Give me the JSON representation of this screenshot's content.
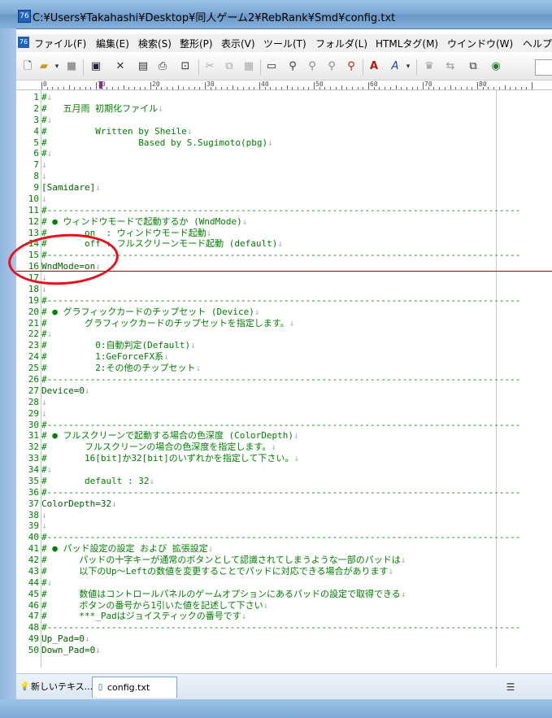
{
  "window": {
    "title": "C:¥Users¥Takahashi¥Desktop¥同人ゲーム2¥RebRank¥Smd¥config.txt",
    "app_icon_text": "76"
  },
  "menu": {
    "icon_text": "76",
    "items": [
      {
        "label": "ファイル(F)"
      },
      {
        "label": "編集(E)"
      },
      {
        "label": "検索(S)"
      },
      {
        "label": "整形(P)"
      },
      {
        "label": "表示(V)"
      },
      {
        "label": "ツール(T)"
      },
      {
        "label": "フォルダ(L)"
      },
      {
        "label": "HTMLタグ(M)"
      },
      {
        "label": "ウインドウ(W)"
      },
      {
        "label": "ヘルプ"
      }
    ]
  },
  "toolbar": {
    "icons": [
      "new-icon",
      "open-icon",
      "dropdown-icon",
      "save-gray-icon",
      "save-icon",
      "close-x-icon",
      "print-preview-icon",
      "print-icon",
      "lock-icon",
      "cut-icon",
      "copy-icon",
      "paste-icon",
      "window-icon",
      "find-icon",
      "find-prev-icon",
      "find-next-icon",
      "replace-icon",
      "font-icon",
      "color-icon",
      "crown-icon",
      "compare-icon",
      "browser-icon"
    ]
  },
  "ruler": {
    "labels": [
      "0",
      "10",
      "20",
      "30",
      "40",
      "50",
      "60",
      "70",
      "80"
    ]
  },
  "editor": {
    "lines": [
      {
        "n": "1",
        "t": "#",
        "e": "↓"
      },
      {
        "n": "2",
        "t": "#   五月雨 初期化ファイル",
        "e": "↓"
      },
      {
        "n": "3",
        "t": "#",
        "e": "↓"
      },
      {
        "n": "4",
        "t": "#         Written by Sheile",
        "e": "↓"
      },
      {
        "n": "5",
        "t": "#                 Based by S.Sugimoto(pbg)",
        "e": "↓"
      },
      {
        "n": "6",
        "t": "#",
        "e": "↓"
      },
      {
        "n": "7",
        "t": "",
        "e": "↓"
      },
      {
        "n": "8",
        "t": "",
        "e": "↓"
      },
      {
        "n": "9",
        "t": "[Samidare]",
        "e": "↓"
      },
      {
        "n": "10",
        "t": "",
        "e": "↓"
      },
      {
        "n": "11",
        "t": "#----------------------------------------------------------------------------------------",
        "e": ""
      },
      {
        "n": "12",
        "t": "# ● ウィンドウモードで起動するか (WndMode)",
        "e": "↓"
      },
      {
        "n": "13",
        "t": "#       on  : ウィンドウモード起動",
        "e": "↓"
      },
      {
        "n": "14",
        "t": "#       off : フルスクリーンモード起動 (default)",
        "e": "↓"
      },
      {
        "n": "15",
        "t": "#----------------------------------------------------------------------------------------",
        "e": ""
      },
      {
        "n": "16",
        "t": "WndMode=on",
        "e": "↓"
      },
      {
        "n": "17",
        "t": "",
        "e": "↓"
      },
      {
        "n": "18",
        "t": "",
        "e": "↓"
      },
      {
        "n": "19",
        "t": "#----------------------------------------------------------------------------------------",
        "e": ""
      },
      {
        "n": "20",
        "t": "# ● グラフィックカードのチップセット (Device)",
        "e": "↓"
      },
      {
        "n": "21",
        "t": "#       グラフィックカードのチップセットを指定します。",
        "e": "↓"
      },
      {
        "n": "22",
        "t": "#",
        "e": "↓"
      },
      {
        "n": "23",
        "t": "#         0:自動判定(Default)",
        "e": "↓"
      },
      {
        "n": "24",
        "t": "#         1:GeForceFX系",
        "e": "↓"
      },
      {
        "n": "25",
        "t": "#         2:その他のチップセット",
        "e": "↓"
      },
      {
        "n": "26",
        "t": "#----------------------------------------------------------------------------------------",
        "e": ""
      },
      {
        "n": "27",
        "t": "Device=0",
        "e": "↓"
      },
      {
        "n": "28",
        "t": "",
        "e": "↓"
      },
      {
        "n": "29",
        "t": "",
        "e": "↓"
      },
      {
        "n": "30",
        "t": "#----------------------------------------------------------------------------------------",
        "e": ""
      },
      {
        "n": "31",
        "t": "# ● フルスクリーンで起動する場合の色深度 (ColorDepth)",
        "e": "↓"
      },
      {
        "n": "32",
        "t": "#       フルスクリーンの場合の色深度を指定します。",
        "e": "↓"
      },
      {
        "n": "33",
        "t": "#       16[bit]か32[bit]のいずれかを指定して下さい。",
        "e": "↓"
      },
      {
        "n": "34",
        "t": "#",
        "e": "↓"
      },
      {
        "n": "35",
        "t": "#       default : 32",
        "e": "↓"
      },
      {
        "n": "36",
        "t": "#----------------------------------------------------------------------------------------",
        "e": ""
      },
      {
        "n": "37",
        "t": "ColorDepth=32",
        "e": "↓"
      },
      {
        "n": "38",
        "t": "",
        "e": "↓"
      },
      {
        "n": "39",
        "t": "",
        "e": "↓"
      },
      {
        "n": "40",
        "t": "#----------------------------------------------------------------------------------------",
        "e": ""
      },
      {
        "n": "41",
        "t": "# ● パッド設定の設定 および 拡張設定",
        "e": "↓"
      },
      {
        "n": "42",
        "t": "#      パッドの十字キーが通常のボタンとして認識されてしまうような一部のパッドは",
        "e": "↓"
      },
      {
        "n": "43",
        "t": "#      以下のUp～Leftの数値を変更することでパッドに対応できる場合があります",
        "e": "↓"
      },
      {
        "n": "44",
        "t": "#",
        "e": "↓"
      },
      {
        "n": "45",
        "t": "#      数値はコントロールパネルのゲームオプションにあるパッドの設定で取得できる",
        "e": "↓"
      },
      {
        "n": "46",
        "t": "#      ボタンの番号から1引いた値を記述して下さい",
        "e": "↓"
      },
      {
        "n": "47",
        "t": "#      ***_Padはジョイスティックの番号です",
        "e": "↓"
      },
      {
        "n": "48",
        "t": "#----------------------------------------------------------------------------------------",
        "e": ""
      },
      {
        "n": "49",
        "t": "Up_Pad=0",
        "e": "↓"
      },
      {
        "n": "50",
        "t": "Down_Pad=0",
        "e": "↓"
      }
    ]
  },
  "tabs": [
    {
      "label": "新しいテキス...",
      "icon": "bulb-icon"
    },
    {
      "label": "config.txt",
      "icon": "document-icon"
    }
  ],
  "colors": {
    "text_green": "#008000",
    "cursor_line": "#a00000",
    "annotation": "#e8101a"
  }
}
